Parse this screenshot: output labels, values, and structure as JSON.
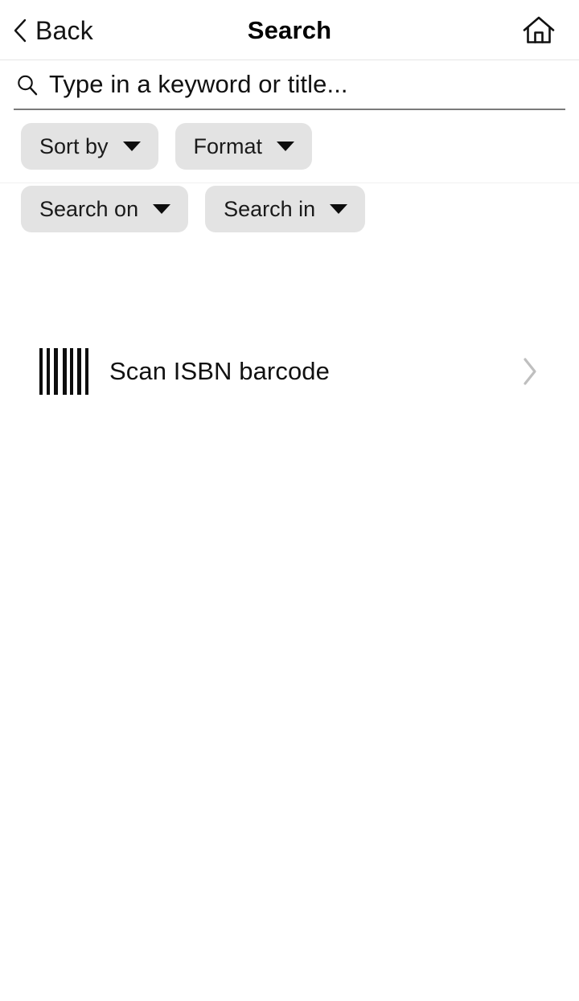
{
  "header": {
    "back_label": "Back",
    "back_icon": "chevron-left-icon",
    "title": "Search",
    "home_icon": "home-icon"
  },
  "search": {
    "icon": "search-icon",
    "placeholder": "Type in a keyword or title...",
    "value": ""
  },
  "filters": {
    "chips": [
      {
        "label": "Sort by",
        "icon": "chevron-down-icon"
      },
      {
        "label": "Format",
        "icon": "chevron-down-icon"
      },
      {
        "label": "Search on",
        "icon": "chevron-down-icon"
      },
      {
        "label": "Search in",
        "icon": "chevron-down-icon"
      }
    ]
  },
  "actions": {
    "scan": {
      "label": "Scan ISBN barcode",
      "leading_icon": "barcode-icon",
      "trailing_icon": "chevron-right-icon"
    }
  },
  "colors": {
    "background": "#ffffff",
    "text": "#111111",
    "chip_background": "#e3e3e3",
    "divider": "#e6e6e6",
    "underline": "#7a7a7a",
    "chevron_grey": "#bfbfbf"
  }
}
